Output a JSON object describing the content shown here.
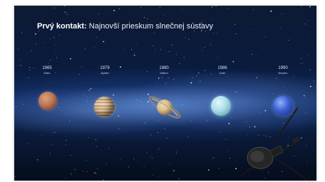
{
  "slide": {
    "title_bold": "Prvý kontakt:",
    "title_rest": " Najnovší prieskum slnečnej sústavy"
  },
  "planets": [
    {
      "year": "1965",
      "name": "Mars"
    },
    {
      "year": "1979",
      "name": "Jupiter"
    },
    {
      "year": "1980",
      "name": "Saturn"
    },
    {
      "year": "1986",
      "name": "Urán"
    },
    {
      "year": "1990",
      "name": "Neptún"
    }
  ],
  "colors": {
    "mars": "#b9765a",
    "jupiter": "#d6b58c",
    "saturn": "#dcc48f",
    "uranus": "#a8dde8",
    "neptune": "#3b5fd1"
  },
  "icons": [
    "star-field",
    "voyager-probe"
  ]
}
